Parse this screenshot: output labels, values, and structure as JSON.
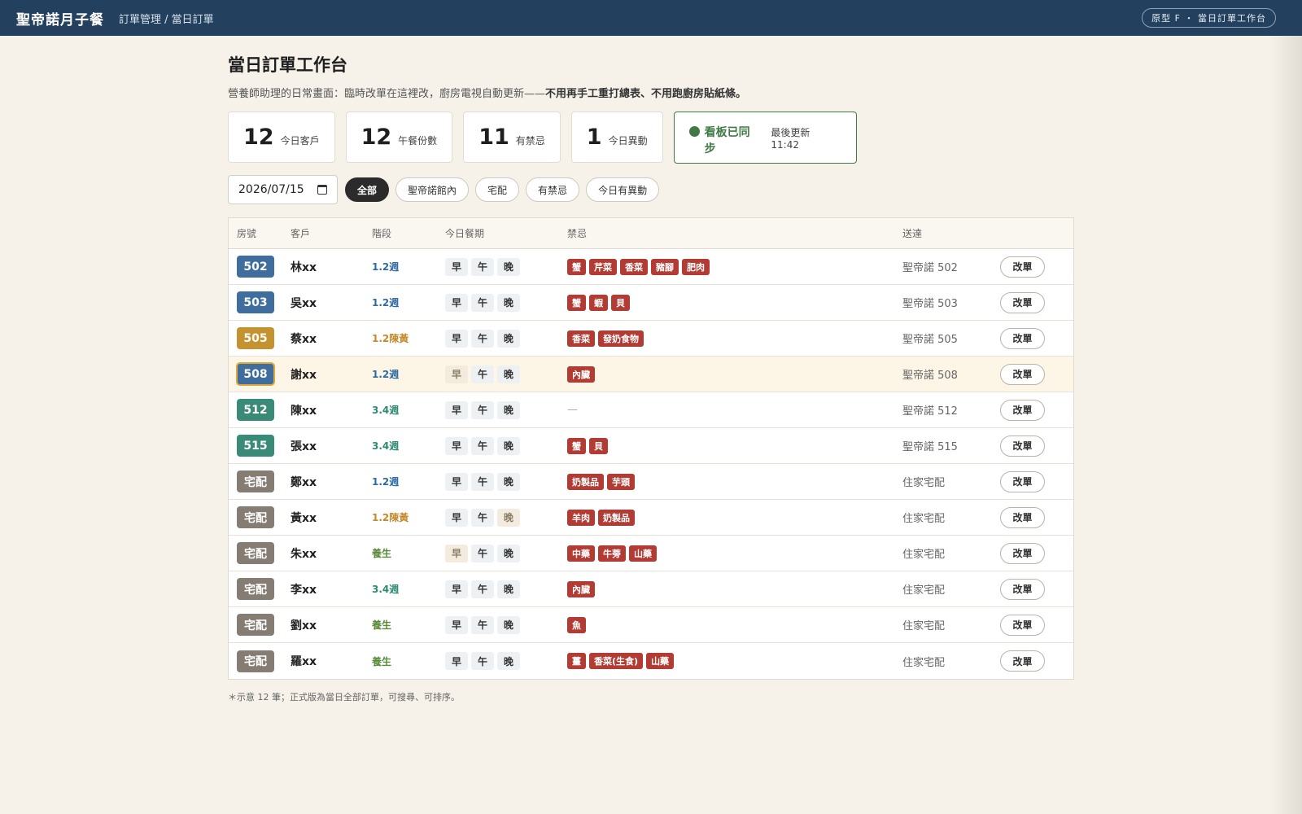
{
  "header": {
    "brand": "聖帝諾月子餐",
    "breadcrumb": "訂單管理 / 當日訂單",
    "prototype_badge": "原型 F ・ 當日訂單工作台"
  },
  "page": {
    "title": "當日訂單工作台",
    "subtitle": "營養師助理的日常畫面：臨時改單在這裡改，廚房電視自動更新——",
    "subtitle_bold": "不用再手工重打總表、不用跑廚房貼紙條。"
  },
  "stats": [
    {
      "value": "12",
      "label": "今日客戶"
    },
    {
      "value": "12",
      "label": "午餐份數"
    },
    {
      "value": "11",
      "label": "有禁忌"
    },
    {
      "value": "1",
      "label": "今日異動"
    }
  ],
  "sync": {
    "status": "看板已同步",
    "updated": "最後更新 11:42",
    "color": "#3f7a45"
  },
  "filters": {
    "date": "2026/07/15",
    "chips": [
      "全部",
      "聖帝諾館內",
      "宅配",
      "有禁忌",
      "今日有異動"
    ],
    "active": "全部"
  },
  "table": {
    "headers": [
      "房號",
      "客戶",
      "階段",
      "今日餐期",
      "禁忌",
      "送達"
    ],
    "meal_labels": [
      "早",
      "午",
      "晚"
    ],
    "edit_label": "改單",
    "rows": [
      {
        "room": "502",
        "room_color": "#3f6e9e",
        "client": "林xx",
        "stage": "1.2週",
        "stage_color": "#2f6aa3",
        "meals_off": [],
        "bans": [
          "蟹",
          "芹菜",
          "香菜",
          "豬腳",
          "肥肉"
        ],
        "delivery": "聖帝諾 502"
      },
      {
        "room": "503",
        "room_color": "#3f6e9e",
        "client": "吳xx",
        "stage": "1.2週",
        "stage_color": "#2f6aa3",
        "meals_off": [],
        "bans": [
          "蟹",
          "蝦",
          "貝"
        ],
        "delivery": "聖帝諾 503"
      },
      {
        "room": "505",
        "room_color": "#c4922f",
        "client": "蔡xx",
        "stage": "1.2陳黃",
        "stage_color": "#c4892a",
        "meals_off": [],
        "bans": [
          "香菜",
          "發奶食物"
        ],
        "delivery": "聖帝諾 505"
      },
      {
        "room": "508",
        "room_color": "#3f6e9e",
        "client": "謝xx",
        "stage": "1.2週",
        "stage_color": "#2f6aa3",
        "meals_off": [
          0
        ],
        "bans": [
          "內臟"
        ],
        "delivery": "聖帝諾 508",
        "highlight": true
      },
      {
        "room": "512",
        "room_color": "#3a8a78",
        "client": "陳xx",
        "stage": "3.4週",
        "stage_color": "#2f8a73",
        "meals_off": [],
        "bans": [],
        "delivery": "聖帝諾 512"
      },
      {
        "room": "515",
        "room_color": "#3a8a78",
        "client": "張xx",
        "stage": "3.4週",
        "stage_color": "#2f8a73",
        "meals_off": [],
        "bans": [
          "蟹",
          "貝"
        ],
        "delivery": "聖帝諾 515"
      },
      {
        "room": "宅配",
        "room_color": "#857d74",
        "client": "鄭xx",
        "stage": "1.2週",
        "stage_color": "#2f6aa3",
        "meals_off": [],
        "bans": [
          "奶製品",
          "芋頭"
        ],
        "delivery": "住家宅配"
      },
      {
        "room": "宅配",
        "room_color": "#857d74",
        "client": "黃xx",
        "stage": "1.2陳黃",
        "stage_color": "#c4892a",
        "meals_off": [
          2
        ],
        "bans": [
          "羊肉",
          "奶製品"
        ],
        "delivery": "住家宅配"
      },
      {
        "room": "宅配",
        "room_color": "#857d74",
        "client": "朱xx",
        "stage": "養生",
        "stage_color": "#5a8a3a",
        "meals_off": [
          0
        ],
        "bans": [
          "中藥",
          "牛蒡",
          "山藥"
        ],
        "delivery": "住家宅配"
      },
      {
        "room": "宅配",
        "room_color": "#857d74",
        "client": "李xx",
        "stage": "3.4週",
        "stage_color": "#2f8a73",
        "meals_off": [],
        "bans": [
          "內臟"
        ],
        "delivery": "住家宅配"
      },
      {
        "room": "宅配",
        "room_color": "#857d74",
        "client": "劉xx",
        "stage": "養生",
        "stage_color": "#5a8a3a",
        "meals_off": [],
        "bans": [
          "魚"
        ],
        "delivery": "住家宅配"
      },
      {
        "room": "宅配",
        "room_color": "#857d74",
        "client": "羅xx",
        "stage": "養生",
        "stage_color": "#5a8a3a",
        "meals_off": [],
        "bans": [
          "薑",
          "香菜(生食)",
          "山藥"
        ],
        "delivery": "住家宅配"
      }
    ]
  },
  "footnote": "＊示意 12 筆；正式版為當日全部訂單，可搜尋、可排序。"
}
